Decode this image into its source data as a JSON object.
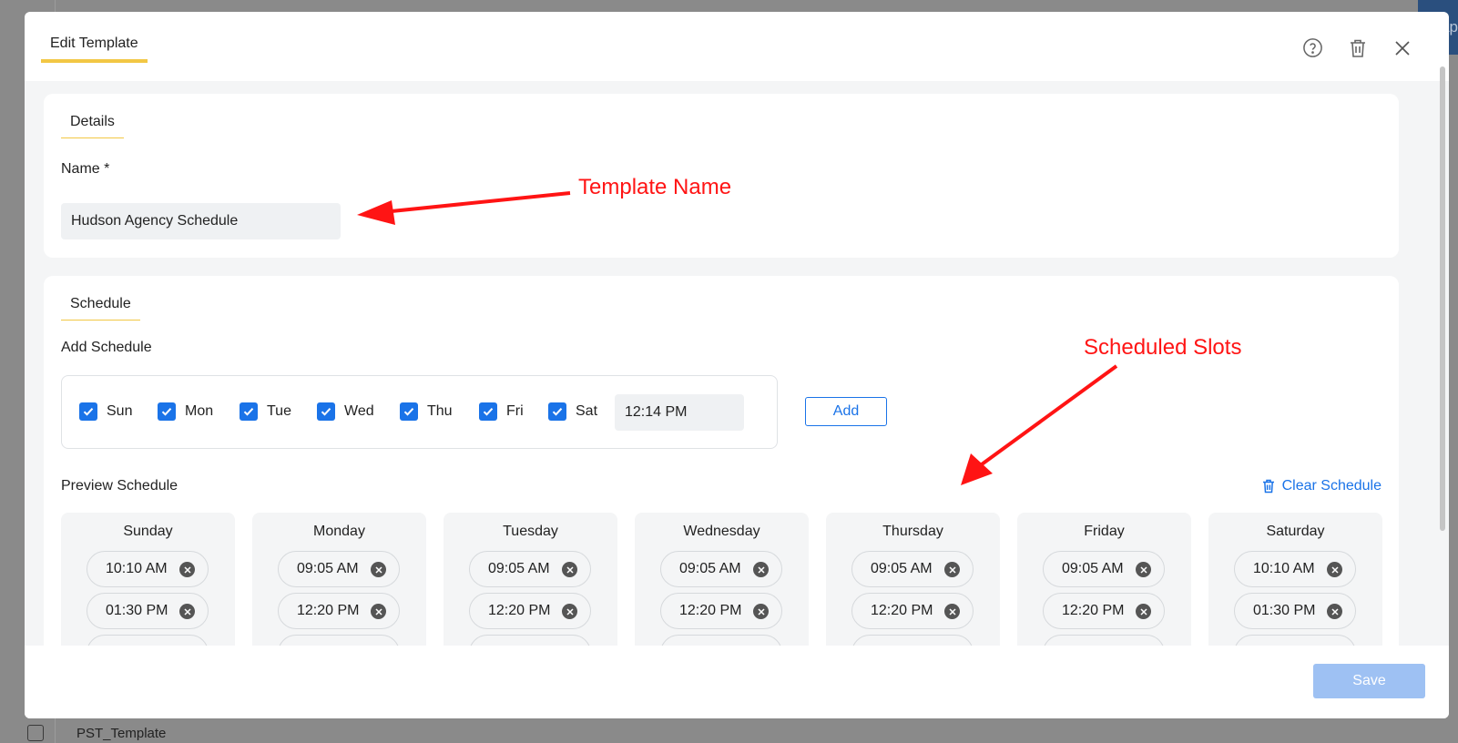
{
  "background": {
    "partial_label": "ap",
    "row_label": "PST_Template"
  },
  "modal": {
    "title": "Edit Template",
    "header_icons": [
      "help-circle-icon",
      "trash-icon",
      "close-icon"
    ],
    "details": {
      "section_label": "Details",
      "name_label": "Name *",
      "name_value": "Hudson Agency Schedule"
    },
    "schedule": {
      "section_label": "Schedule",
      "add_label": "Add Schedule",
      "days": [
        {
          "label": "Sun",
          "checked": true
        },
        {
          "label": "Mon",
          "checked": true
        },
        {
          "label": "Tue",
          "checked": true
        },
        {
          "label": "Wed",
          "checked": true
        },
        {
          "label": "Thu",
          "checked": true
        },
        {
          "label": "Fri",
          "checked": true
        },
        {
          "label": "Sat",
          "checked": true
        }
      ],
      "time_value": "12:14 PM",
      "add_button": "Add",
      "preview_label": "Preview Schedule",
      "clear_button": "Clear Schedule",
      "preview": [
        {
          "day": "Sunday",
          "slots": [
            "10:10 AM",
            "01:30 PM"
          ]
        },
        {
          "day": "Monday",
          "slots": [
            "09:05 AM",
            "12:20 PM"
          ]
        },
        {
          "day": "Tuesday",
          "slots": [
            "09:05 AM",
            "12:20 PM"
          ]
        },
        {
          "day": "Wednesday",
          "slots": [
            "09:05 AM",
            "12:20 PM"
          ]
        },
        {
          "day": "Thursday",
          "slots": [
            "09:05 AM",
            "12:20 PM"
          ]
        },
        {
          "day": "Friday",
          "slots": [
            "09:05 AM",
            "12:20 PM"
          ]
        },
        {
          "day": "Saturday",
          "slots": [
            "10:10 AM",
            "01:30 PM"
          ]
        }
      ]
    },
    "save_button": "Save"
  },
  "annotations": {
    "template_name": "Template Name",
    "scheduled_slots": "Scheduled Slots",
    "color": "#ff1414"
  },
  "colors": {
    "accent": "#f2c744",
    "primary": "#1a73e8",
    "save_disabled": "#9ec1f3"
  }
}
